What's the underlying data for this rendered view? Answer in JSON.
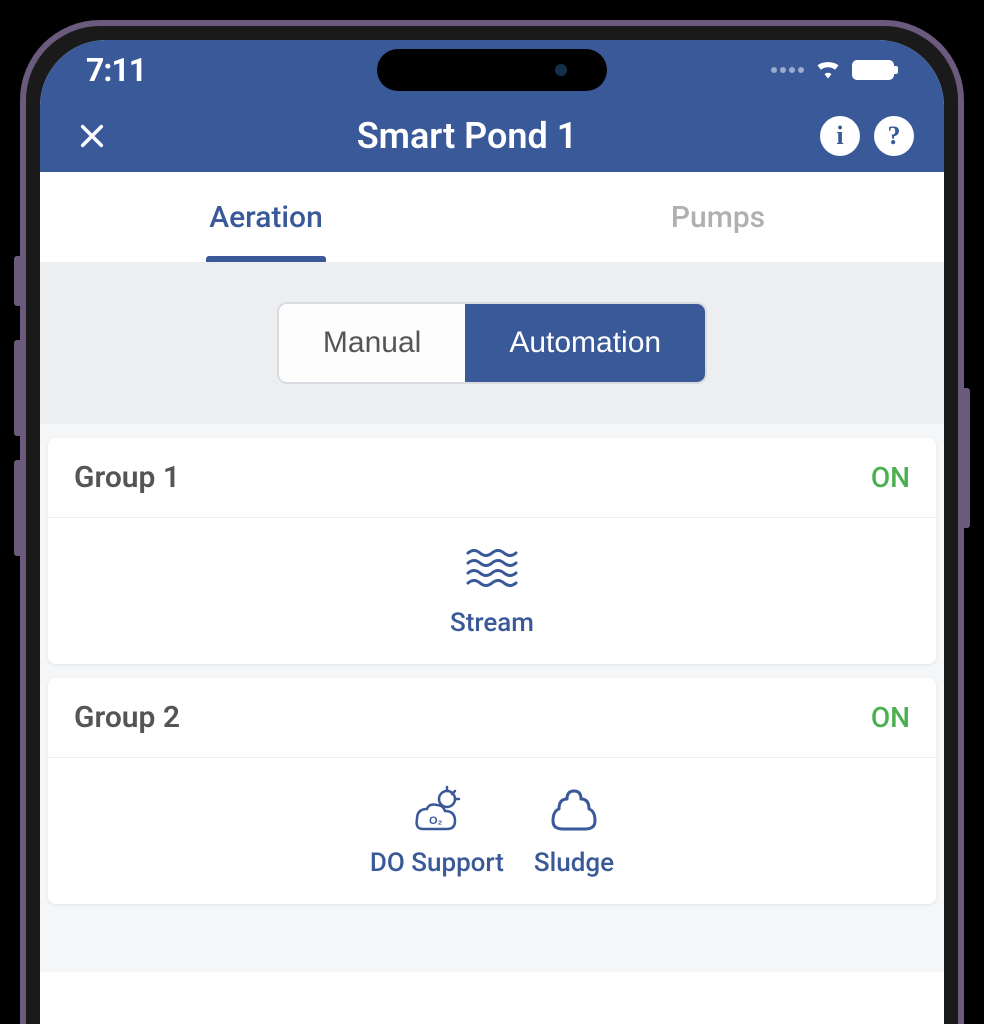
{
  "status": {
    "time": "7:11"
  },
  "header": {
    "title": "Smart Pond 1"
  },
  "tabs": [
    {
      "label": "Aeration",
      "active": true
    },
    {
      "label": "Pumps",
      "active": false
    }
  ],
  "mode": {
    "manual_label": "Manual",
    "automation_label": "Automation",
    "active": "automation"
  },
  "groups": [
    {
      "name": "Group 1",
      "status": "ON",
      "features": [
        {
          "label": "Stream",
          "icon": "waves"
        }
      ]
    },
    {
      "name": "Group 2",
      "status": "ON",
      "features": [
        {
          "label": "DO Support",
          "icon": "do-support"
        },
        {
          "label": "Sludge",
          "icon": "sludge"
        }
      ]
    }
  ]
}
